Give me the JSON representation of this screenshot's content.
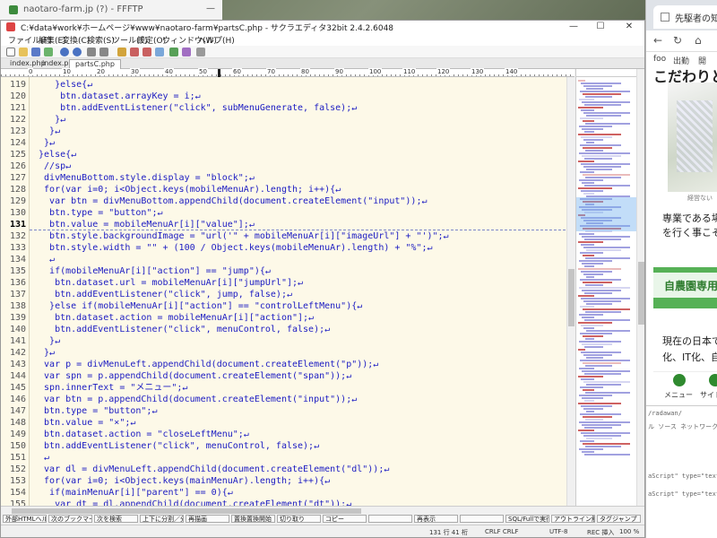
{
  "back_window": {
    "title": "naotaro-farm.jp (?) - FFFTP"
  },
  "browser": {
    "tab_title": "先駆者の知",
    "bookmarks": [
      "foo",
      "出勤",
      "開"
    ],
    "hero_title": "こだわりと",
    "caption": "経営ない",
    "text1_lines": [
      "専業である場",
      "を行く事こそ"
    ],
    "green_title": "自農園専用",
    "text2_lines": [
      "現在の日本で",
      "化、IT化、自"
    ],
    "icon_labels": [
      "メニュー",
      "サイトマ"
    ],
    "devtools_lines": [
      "/radawan/",
      "ル  ソース  ネットワーク",
      "aScript\" type=\"text/javascri",
      "aScript\" type=\"text/javascri"
    ]
  },
  "editor": {
    "title": "C:¥data¥work¥ホームページ¥www¥naotaro-farm¥partsC.php - サクラエディタ32bit 2.4.2.6048",
    "window_buttons": [
      "—",
      "☐",
      "✕"
    ],
    "menu": [
      "ファイル(F)",
      "編集(E)",
      "変換(C)",
      "検索(S)",
      "ツール(T)",
      "設定(O)",
      "ウィンドウ(W)",
      "ヘルプ(H)"
    ],
    "tabs": [
      "index.php",
      "index.php",
      "partsC.php"
    ],
    "active_tab": 2,
    "ruler_marks": [
      "0",
      "10",
      "20",
      "30",
      "40",
      "50",
      "60",
      "70",
      "80",
      "90",
      "100",
      "110",
      "120",
      "130",
      "140"
    ],
    "current_line": 131,
    "lines": [
      {
        "n": "119",
        "t": "    }else{↵"
      },
      {
        "n": "120",
        "t": "     btn.dataset.arrayKey = i;↵"
      },
      {
        "n": "121",
        "t": "     btn.addEventListener(\"click\", subMenuGenerate, false);↵"
      },
      {
        "n": "122",
        "t": "    }↵"
      },
      {
        "n": "123",
        "t": "   }↵"
      },
      {
        "n": "124",
        "t": "  }↵"
      },
      {
        "n": "125",
        "t": " }else{↵"
      },
      {
        "n": "126",
        "t": "  //sp↵"
      },
      {
        "n": "127",
        "t": "  divMenuBottom.style.display = \"block\";↵"
      },
      {
        "n": "128",
        "t": "  for(var i=0; i<Object.keys(mobileMenuAr).length; i++){↵"
      },
      {
        "n": "129",
        "t": "   var btn = divMenuBottom.appendChild(document.createElement(\"input\"));↵"
      },
      {
        "n": "130",
        "t": "   btn.type = \"button\";↵"
      },
      {
        "n": "131",
        "t": "   btn.value = mobileMenuAr[i][\"value\"];↵"
      },
      {
        "n": "132",
        "t": "   btn.style.backgroundImage = \"url('\" + mobileMenuAr[i][\"imageUrl\"] + \"')\";↵"
      },
      {
        "n": "133",
        "t": "   btn.style.width = \"\" + (100 / Object.keys(mobileMenuAr).length) + \"%\";↵"
      },
      {
        "n": "134",
        "t": "   ↵"
      },
      {
        "n": "135",
        "t": "   if(mobileMenuAr[i][\"action\"] == \"jump\"){↵"
      },
      {
        "n": "136",
        "t": "    btn.dataset.url = mobileMenuAr[i][\"jumpUrl\"];↵"
      },
      {
        "n": "137",
        "t": "    btn.addEventListener(\"click\", jump, false);↵"
      },
      {
        "n": "138",
        "t": "   }else if(mobileMenuAr[i][\"action\"] == \"controlLeftMenu\"){↵"
      },
      {
        "n": "139",
        "t": "    btn.dataset.action = mobileMenuAr[i][\"action\"];↵"
      },
      {
        "n": "140",
        "t": "    btn.addEventListener(\"click\", menuControl, false);↵"
      },
      {
        "n": "141",
        "t": "   }↵"
      },
      {
        "n": "142",
        "t": "  }↵"
      },
      {
        "n": "143",
        "t": "  var p = divMenuLeft.appendChild(document.createElement(\"p\"));↵"
      },
      {
        "n": "144",
        "t": "  var spn = p.appendChild(document.createElement(\"span\"));↵"
      },
      {
        "n": "145",
        "t": "  spn.innerText = \"メニュー\";↵"
      },
      {
        "n": "146",
        "t": "  var btn = p.appendChild(document.createElement(\"input\"));↵"
      },
      {
        "n": "147",
        "t": "  btn.type = \"button\";↵"
      },
      {
        "n": "148",
        "t": "  btn.value = \"×\";↵"
      },
      {
        "n": "149",
        "t": "  btn.dataset.action = \"closeLeftMenu\";↵"
      },
      {
        "n": "150",
        "t": "  btn.addEventListener(\"click\", menuControl, false);↵"
      },
      {
        "n": "151",
        "t": "  ↵"
      },
      {
        "n": "152",
        "t": "  var dl = divMenuLeft.appendChild(document.createElement(\"dl\"));↵"
      },
      {
        "n": "153",
        "t": "  for(var i=0; i<Object.keys(mainMenuAr).length; i++){↵"
      },
      {
        "n": "154",
        "t": "   if(mainMenuAr[i][\"parent\"] == 0){↵"
      },
      {
        "n": "155",
        "t": "    var dt = dl.appendChild(document.createElement(\"dt\"));↵"
      },
      {
        "n": "156",
        "t": "    dt.innerText = mainMenuAr[i][\"value\"];↵"
      },
      {
        "n": "157",
        "t": "   }else if(mainMenuAr[i][\"parent\"] > 0){↵"
      }
    ],
    "function_keys": [
      "外部HTMLヘルプ",
      "次のブックマークへ",
      "次を検索",
      "上下に分割／分割解除",
      "再描画",
      "置換置換開始",
      "切り取り",
      "コピー",
      "",
      "再表示",
      "",
      "SQL/Fullで実行",
      "アウトライン解析",
      "タグジャンプ"
    ],
    "status": {
      "position": "131 行  41 桁",
      "line_ending": "CRLF  CRLF",
      "encoding": "UTF-8",
      "mode": "REC 挿入",
      "zoom": "100 %"
    }
  },
  "colors": {
    "code_text": "#1b1bc2",
    "code_bg": "#fdf9e8",
    "minimap_highlight": "#9ccbf3",
    "green_accent": "#56b156"
  }
}
